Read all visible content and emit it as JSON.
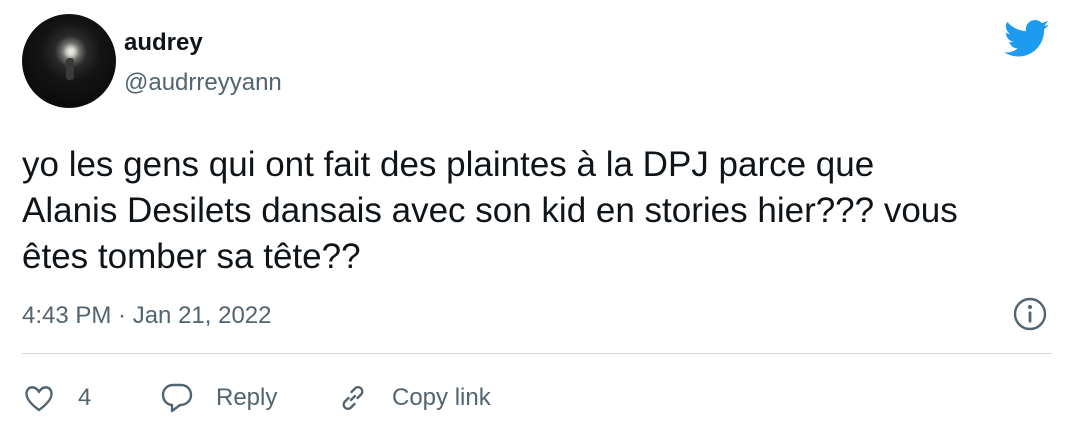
{
  "author": {
    "display_name": "audrey",
    "handle": "@audrreyyann"
  },
  "tweet": {
    "text": "yo les gens qui ont fait des plaintes à la DPJ parce que\nAlanis Desilets dansais avec son kid en stories hier??? vous\nêtes tomber sa tête??",
    "timestamp": "4:43 PM · Jan 21, 2022"
  },
  "actions": {
    "like_count": "4",
    "reply_label": "Reply",
    "copy_label": "Copy link"
  },
  "icons": {
    "brand": "twitter-bird-icon",
    "info": "info-icon",
    "like": "heart-icon",
    "reply": "speech-bubble-icon",
    "copy": "link-icon"
  },
  "colors": {
    "brand_blue": "#1d9bf0",
    "text_primary": "#0f1419",
    "text_secondary": "#536471",
    "divider": "#cfd9de"
  }
}
